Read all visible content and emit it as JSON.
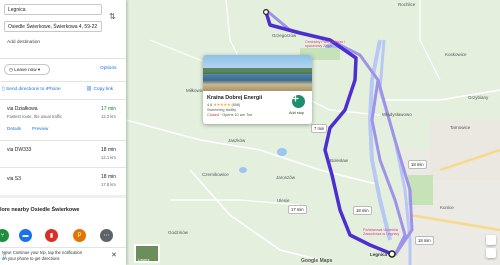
{
  "directions": {
    "origin_value": "Legnica",
    "destination_value": "Osiedle Świerkowe, Świerkowa 4, 59-22",
    "add_destination": "Add destination",
    "leave_now": "Leave now",
    "options": "Options",
    "send_to_phone": "Send directions to iPhone",
    "copy_link": "Copy link"
  },
  "routes": [
    {
      "name": "via Działkowa",
      "time": "17 min",
      "distance": "12.2 km",
      "note": "Fastest route, the usual traffic",
      "details": "Details",
      "preview": "Preview"
    },
    {
      "name": "via DW333",
      "time": "18 min",
      "distance": "12.1 km"
    },
    {
      "name": "via S3",
      "time": "18 min",
      "distance": "17.8 km"
    }
  ],
  "nearby_title": "lore nearby Osiedle Świerkowe",
  "notification": {
    "line1": "New! Continue your trip, tap the notification",
    "line2": "on your phone to get directions"
  },
  "place_card": {
    "name": "Kraina Dobrej Energii",
    "rating": "4.6",
    "stars": "★★★★★",
    "reviews": "(658)",
    "category": "Swimming facility",
    "hours_closed": "Closed",
    "hours_rest": " · Opens 10 am Tue",
    "add_stop": "Add stop"
  },
  "map": {
    "labels": {
      "rochlice": "Rochlice",
      "koskowice": "Koskowice",
      "milkowice": "Miłkowice",
      "winiszw": "Władysławowo",
      "jaszkow": "Jaszków",
      "bolesl": "Bolesław",
      "grzegorzow": "Grzegorzów",
      "czerniki": "Czernikowice",
      "jaroszow": "Jaroszów",
      "godzin": "Godzinów",
      "ulesie": "Ulesie",
      "legnica": "Legnica",
      "tarnow": "Tarnowice",
      "pwsz": "Państwowa Uczelnia Zawodowa w Legnicy",
      "grzyb": "Grzybiany",
      "lake": "Centralny Park Kwiatów i spacerowy Zegar",
      "kunice": "Kunice"
    },
    "badges": {
      "b1": "18 min",
      "b2": "18 min",
      "b3": "17 min",
      "b4": "18 min"
    },
    "exit_label": "7 min",
    "layers_label": "Layers",
    "google_logo": "Google Maps",
    "cluster": "+1"
  },
  "colors": {
    "route": "#4b2fd0",
    "accent": "#1a73e8",
    "green": "#188038"
  }
}
